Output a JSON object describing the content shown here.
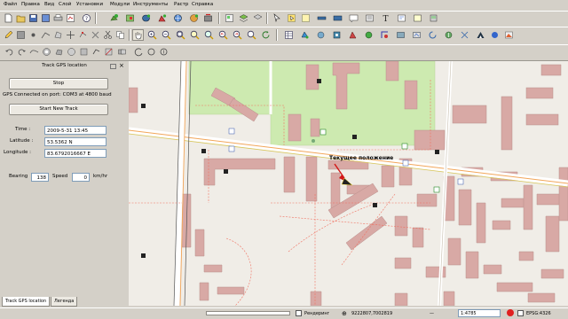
{
  "menu": {
    "items": [
      "Файл",
      "Правка",
      "Вид",
      "Слой",
      "Установки",
      "Модули",
      "Инструменты",
      "Растр",
      "Справка"
    ]
  },
  "gps_panel": {
    "title": "Track GPS location",
    "stop_label": "Stop",
    "connection_text": "GPS Connected on port: COM3 at 4800 baud",
    "new_track_label": "Start New Track",
    "time_label": "Time :",
    "time_value": "2009-5-31 13:45",
    "latitude_label": "Latitude :",
    "latitude_value": "53.5362 N",
    "longitude_label": "Longitude :",
    "longitude_value": "83.6792016667 E",
    "bearing_label": "Bearing",
    "bearing_value": "138",
    "speed_label": "Speed",
    "speed_value": "0",
    "speed_unit": "km/hr",
    "tabs": [
      "Track GPS location",
      "Легенда"
    ]
  },
  "map": {
    "position_label": "Текущее положение"
  },
  "statusbar": {
    "render_label": "Рендеринг",
    "coords": "9222807,7002819",
    "scale_value": "1:4785",
    "projection_label": "EPSG:4326"
  },
  "colors": {
    "building": "#d8a9a5",
    "building_stroke": "#b98f8b",
    "park": "#cdeab0",
    "road_orange": "#f2a65a",
    "rail": "#555555",
    "footpath": "#f07060",
    "land": "#f0ede7"
  }
}
